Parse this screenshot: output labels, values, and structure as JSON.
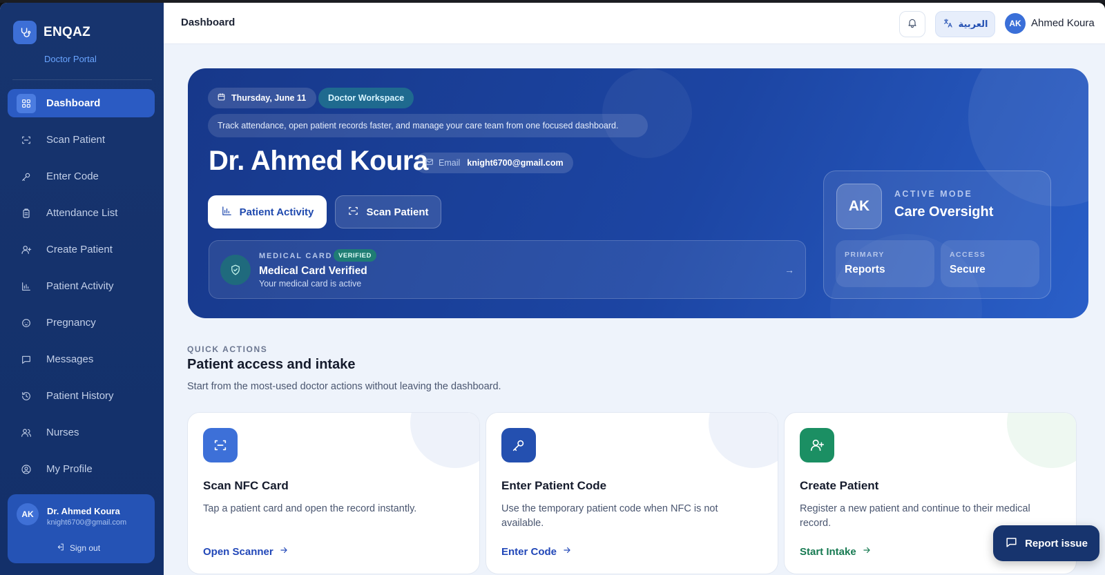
{
  "brand": {
    "name": "ENQAZ",
    "subtitle": "Doctor Portal",
    "logo_icon": "stethoscope-icon",
    "color": "#3d6fd6"
  },
  "sidebar": {
    "items": [
      {
        "label": "Dashboard",
        "icon": "grid-icon",
        "active": true
      },
      {
        "label": "Scan Patient",
        "icon": "scan-icon",
        "active": false
      },
      {
        "label": "Enter Code",
        "icon": "key-icon",
        "active": false
      },
      {
        "label": "Attendance List",
        "icon": "clipboard-icon",
        "active": false
      },
      {
        "label": "Create Patient",
        "icon": "user-plus-icon",
        "active": false
      },
      {
        "label": "Patient Activity",
        "icon": "bar-chart-icon",
        "active": false
      },
      {
        "label": "Pregnancy",
        "icon": "baby-icon",
        "active": false
      },
      {
        "label": "Messages",
        "icon": "message-icon",
        "active": false
      },
      {
        "label": "Patient History",
        "icon": "history-icon",
        "active": false
      },
      {
        "label": "Nurses",
        "icon": "users-icon",
        "active": false
      },
      {
        "label": "My Profile",
        "icon": "user-circle-icon",
        "active": false
      }
    ],
    "user": {
      "initials": "AK",
      "name": "Dr. Ahmed Koura",
      "email": "knight6700@gmail.com",
      "signout_label": "Sign out"
    }
  },
  "topbar": {
    "title": "Dashboard",
    "language_label": "العربية",
    "user_initials": "AK",
    "user_name": "Ahmed Koura"
  },
  "hero": {
    "date": "Thursday, June 11",
    "workspace": "Doctor Workspace",
    "note": "Track attendance, open patient records faster, and manage your care team from one focused dashboard.",
    "doctor_name": "Dr. Ahmed Koura",
    "email_label": "Email",
    "email_value": "knight6700@gmail.com",
    "primary_button": "Patient Activity",
    "secondary_button": "Scan Patient",
    "medical_card": {
      "label": "MEDICAL CARD",
      "badge": "VERIFIED",
      "title": "Medical Card Verified",
      "subtitle": "Your medical card is active"
    },
    "mode": {
      "initials": "AK",
      "label": "ACTIVE MODE",
      "value": "Care Oversight",
      "tiles": [
        {
          "label": "PRIMARY",
          "value": "Reports"
        },
        {
          "label": "ACCESS",
          "value": "Secure"
        }
      ]
    }
  },
  "quick_actions": {
    "kicker": "QUICK ACTIONS",
    "title": "Patient access and intake",
    "subtitle": "Start from the most-used doctor actions without leaving the dashboard.",
    "cards": [
      {
        "name": "Scan NFC Card",
        "desc": "Tap a patient card and open the record instantly.",
        "link": "Open Scanner",
        "icon": "scan-icon",
        "color": "#3d70d8",
        "link_color": "#2147b8"
      },
      {
        "name": "Enter Patient Code",
        "desc": "Use the temporary patient code when NFC is not available.",
        "link": "Enter Code",
        "icon": "key-icon",
        "color": "#2450b0",
        "link_color": "#2147b8"
      },
      {
        "name": "Create Patient",
        "desc": "Register a new patient and continue to their medical record.",
        "link": "Start Intake",
        "icon": "user-plus-icon",
        "color": "#1b8f63",
        "link_color": "#177a52"
      }
    ]
  },
  "report_issue": {
    "label": "Report issue",
    "icon": "chat-icon"
  }
}
